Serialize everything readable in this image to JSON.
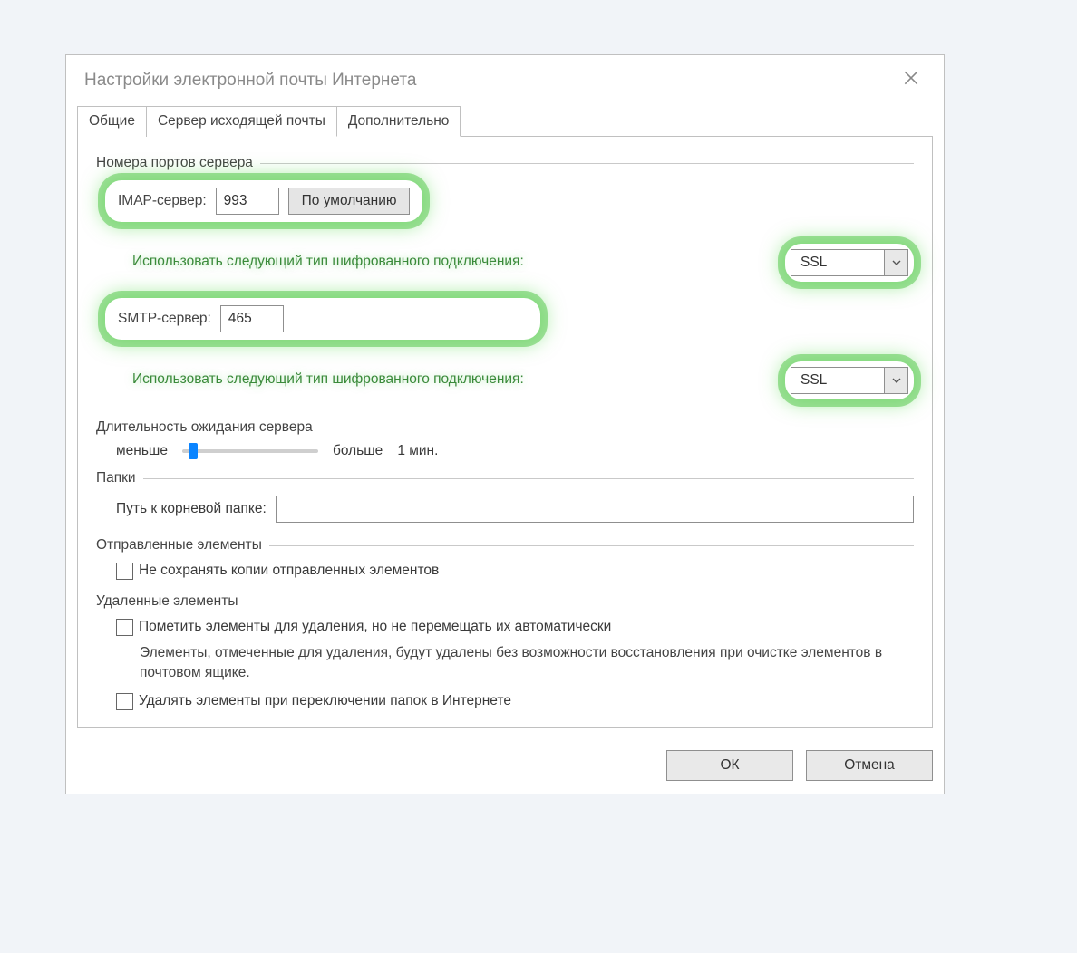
{
  "dialog": {
    "title": "Настройки электронной почты Интернета"
  },
  "tabs": {
    "general": "Общие",
    "outgoing": "Сервер исходящей почты",
    "advanced": "Дополнительно"
  },
  "groups": {
    "ports": "Номера портов сервера",
    "timeout": "Длительность ожидания сервера",
    "folders": "Папки",
    "sent": "Отправленные элементы",
    "deleted": "Удаленные элементы"
  },
  "ports": {
    "imap_label": "IMAP-сервер:",
    "imap_value": "993",
    "default_button": "По умолчанию",
    "smtp_label": "SMTP-сервер:",
    "smtp_value": "465",
    "enc_label": "Использовать следующий тип шифрованного подключения:",
    "imap_encryption": "SSL",
    "smtp_encryption": "SSL"
  },
  "timeout": {
    "less": "меньше",
    "more": "больше",
    "value_label": "1 мин."
  },
  "folders": {
    "root_label": "Путь к корневой папке:",
    "root_value": ""
  },
  "sent": {
    "no_save_label": "Не сохранять копии отправленных элементов"
  },
  "deleted": {
    "mark_label": "Пометить элементы для удаления, но не перемещать их автоматически",
    "mark_note": "Элементы, отмеченные для удаления, будут удалены без возможности восстановления при очистке элементов в почтовом ящике.",
    "purge_label": "Удалять элементы при переключении папок в Интернете"
  },
  "footer": {
    "ok": "ОК",
    "cancel": "Отмена"
  }
}
